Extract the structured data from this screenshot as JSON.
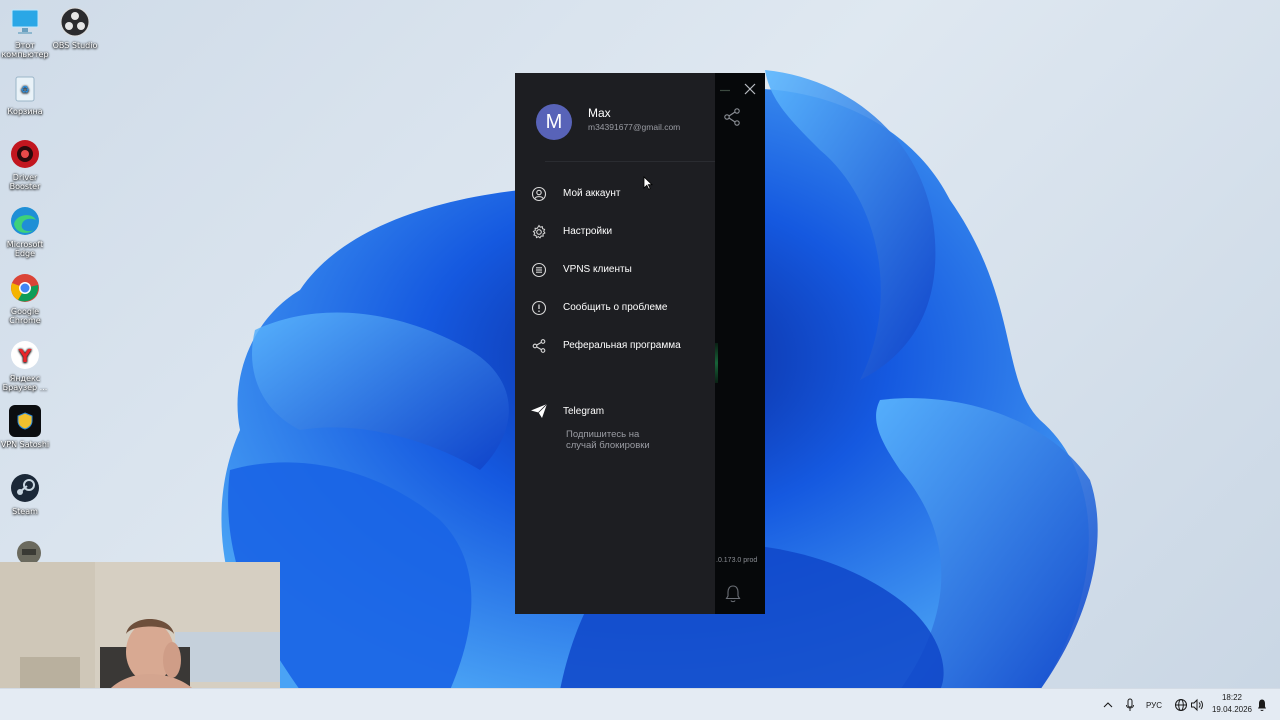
{
  "desktop": {
    "icons": [
      {
        "label": "Этот компьютер",
        "icon": "monitor-icon"
      },
      {
        "label": "OBS Studio",
        "icon": "obs-icon"
      },
      {
        "label": "Корзина",
        "icon": "recycle-bin-icon"
      },
      {
        "label": "Driver Booster",
        "icon": "driver-booster-icon"
      },
      {
        "label": "Microsoft Edge",
        "icon": "edge-icon"
      },
      {
        "label": "Google Chrome",
        "icon": "chrome-icon"
      },
      {
        "label": "Яндекс Браузер ...",
        "icon": "yandex-icon"
      },
      {
        "label": "VPN Satoshi",
        "icon": "vpn-satoshi-icon"
      },
      {
        "label": "Steam",
        "icon": "steam-icon"
      }
    ]
  },
  "app": {
    "user": {
      "avatar_letter": "M",
      "name": "Max",
      "email": "m34391677@gmail.com"
    },
    "menu": [
      {
        "label": "Мой аккаунт",
        "icon": "account-icon"
      },
      {
        "label": "Настройки",
        "icon": "gear-icon"
      },
      {
        "label": "VPNS клиенты",
        "icon": "list-icon"
      },
      {
        "label": "Сообщить о проблеме",
        "icon": "alert-icon"
      },
      {
        "label": "Реферальная программа",
        "icon": "share-icon"
      }
    ],
    "telegram": {
      "label": "Telegram",
      "subtitle": "Подпишитесь на случай блокировки"
    },
    "version": ".0.173.0 prod",
    "colors": {
      "drawer_bg": "#1d1e22",
      "window_bg": "#06080a",
      "avatar_bg": "#5863b8"
    }
  },
  "taskbar": {
    "language": "РУС",
    "time": "18:22",
    "date": "19.04.2026"
  }
}
